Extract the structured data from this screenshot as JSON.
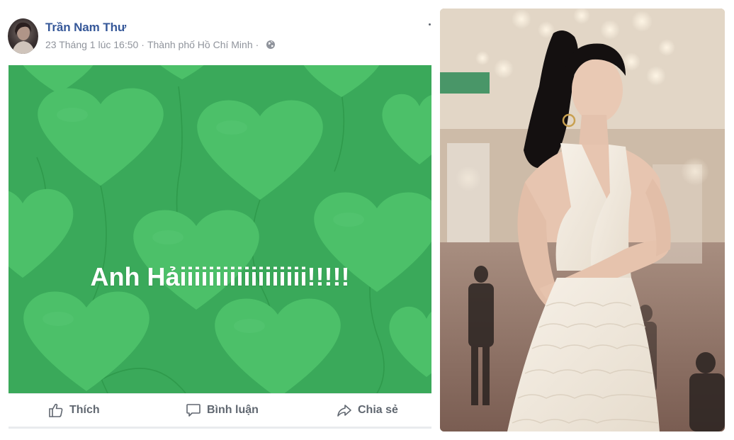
{
  "post": {
    "author_name": "Trần Nam Thư",
    "timestamp": "23 Tháng 1 lúc 16:50",
    "location": "Thành phố Hồ Chí Minh",
    "separator": "·",
    "status_text": "Anh Hảiiiiiiiiiiiiiiiiii!!!!!",
    "background_color": "#3aa95a",
    "heart_color": "#4cc069",
    "privacy_icon": "globe-icon"
  },
  "actions": {
    "like_label": "Thích",
    "comment_label": "Bình luận",
    "share_label": "Chia sẻ",
    "like_icon": "thumbs-up-icon",
    "comment_icon": "speech-bubble-icon",
    "share_icon": "share-arrow-icon"
  },
  "colors": {
    "author_link": "#365899",
    "meta_text": "#90949c",
    "action_text": "#606770"
  }
}
